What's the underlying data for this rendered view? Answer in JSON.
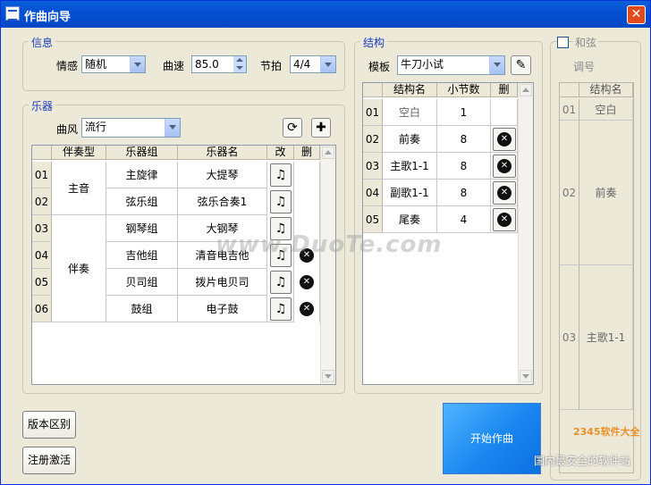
{
  "window": {
    "title": "作曲向导"
  },
  "info": {
    "legend": "信息",
    "mood_label": "情感",
    "mood_value": "随机",
    "tempo_label": "曲速",
    "tempo_value": "85.0",
    "beat_label": "节拍",
    "beat_value": "4/4"
  },
  "instruments": {
    "legend": "乐器",
    "style_label": "曲风",
    "style_value": "流行",
    "headers": [
      "伴奏型",
      "乐器组",
      "乐器名",
      "改",
      "删"
    ],
    "row_numbers": [
      "01",
      "02",
      "03",
      "04",
      "05",
      "06"
    ],
    "types": [
      "主音",
      "伴奏"
    ],
    "rows": [
      {
        "group": "主旋律",
        "name": "大提琴",
        "deletable": false
      },
      {
        "group": "弦乐组",
        "name": "弦乐合奏1",
        "deletable": false
      },
      {
        "group": "钢琴组",
        "name": "大钢琴",
        "deletable": false
      },
      {
        "group": "吉他组",
        "name": "清音电吉他",
        "deletable": true
      },
      {
        "group": "贝司组",
        "name": "拨片电贝司",
        "deletable": true
      },
      {
        "group": "鼓组",
        "name": "电子鼓",
        "deletable": true
      }
    ]
  },
  "structure": {
    "legend": "结构",
    "template_label": "模板",
    "template_value": "牛刀小试",
    "headers": [
      "结构名",
      "小节数",
      "删"
    ],
    "rows": [
      {
        "num": "01",
        "name": "空白",
        "bars": "1",
        "deletable": false
      },
      {
        "num": "02",
        "name": "前奏",
        "bars": "8",
        "deletable": true
      },
      {
        "num": "03",
        "name": "主歌1-1",
        "bars": "8",
        "deletable": true
      },
      {
        "num": "04",
        "name": "副歌1-1",
        "bars": "8",
        "deletable": true
      },
      {
        "num": "05",
        "name": "尾奏",
        "bars": "4",
        "deletable": true
      }
    ]
  },
  "chord": {
    "legend": "和弦",
    "key_label": "调号",
    "header": "结构名",
    "rows": [
      {
        "num": "01",
        "name": "空白"
      },
      {
        "num": "02",
        "name": "前奏"
      },
      {
        "num": "03",
        "name": "主歌1-1"
      }
    ]
  },
  "buttons": {
    "version": "版本区别",
    "register": "注册激活",
    "start": "开始作曲"
  },
  "watermarks": {
    "main": "www.DuoTe.com",
    "corner": "2345软件大全",
    "corner_sub": "国内最安全的软件站"
  },
  "colors": {
    "titlebar": "#0551d3",
    "legend": "#1b3db9",
    "start_button": "#1a86f0"
  }
}
